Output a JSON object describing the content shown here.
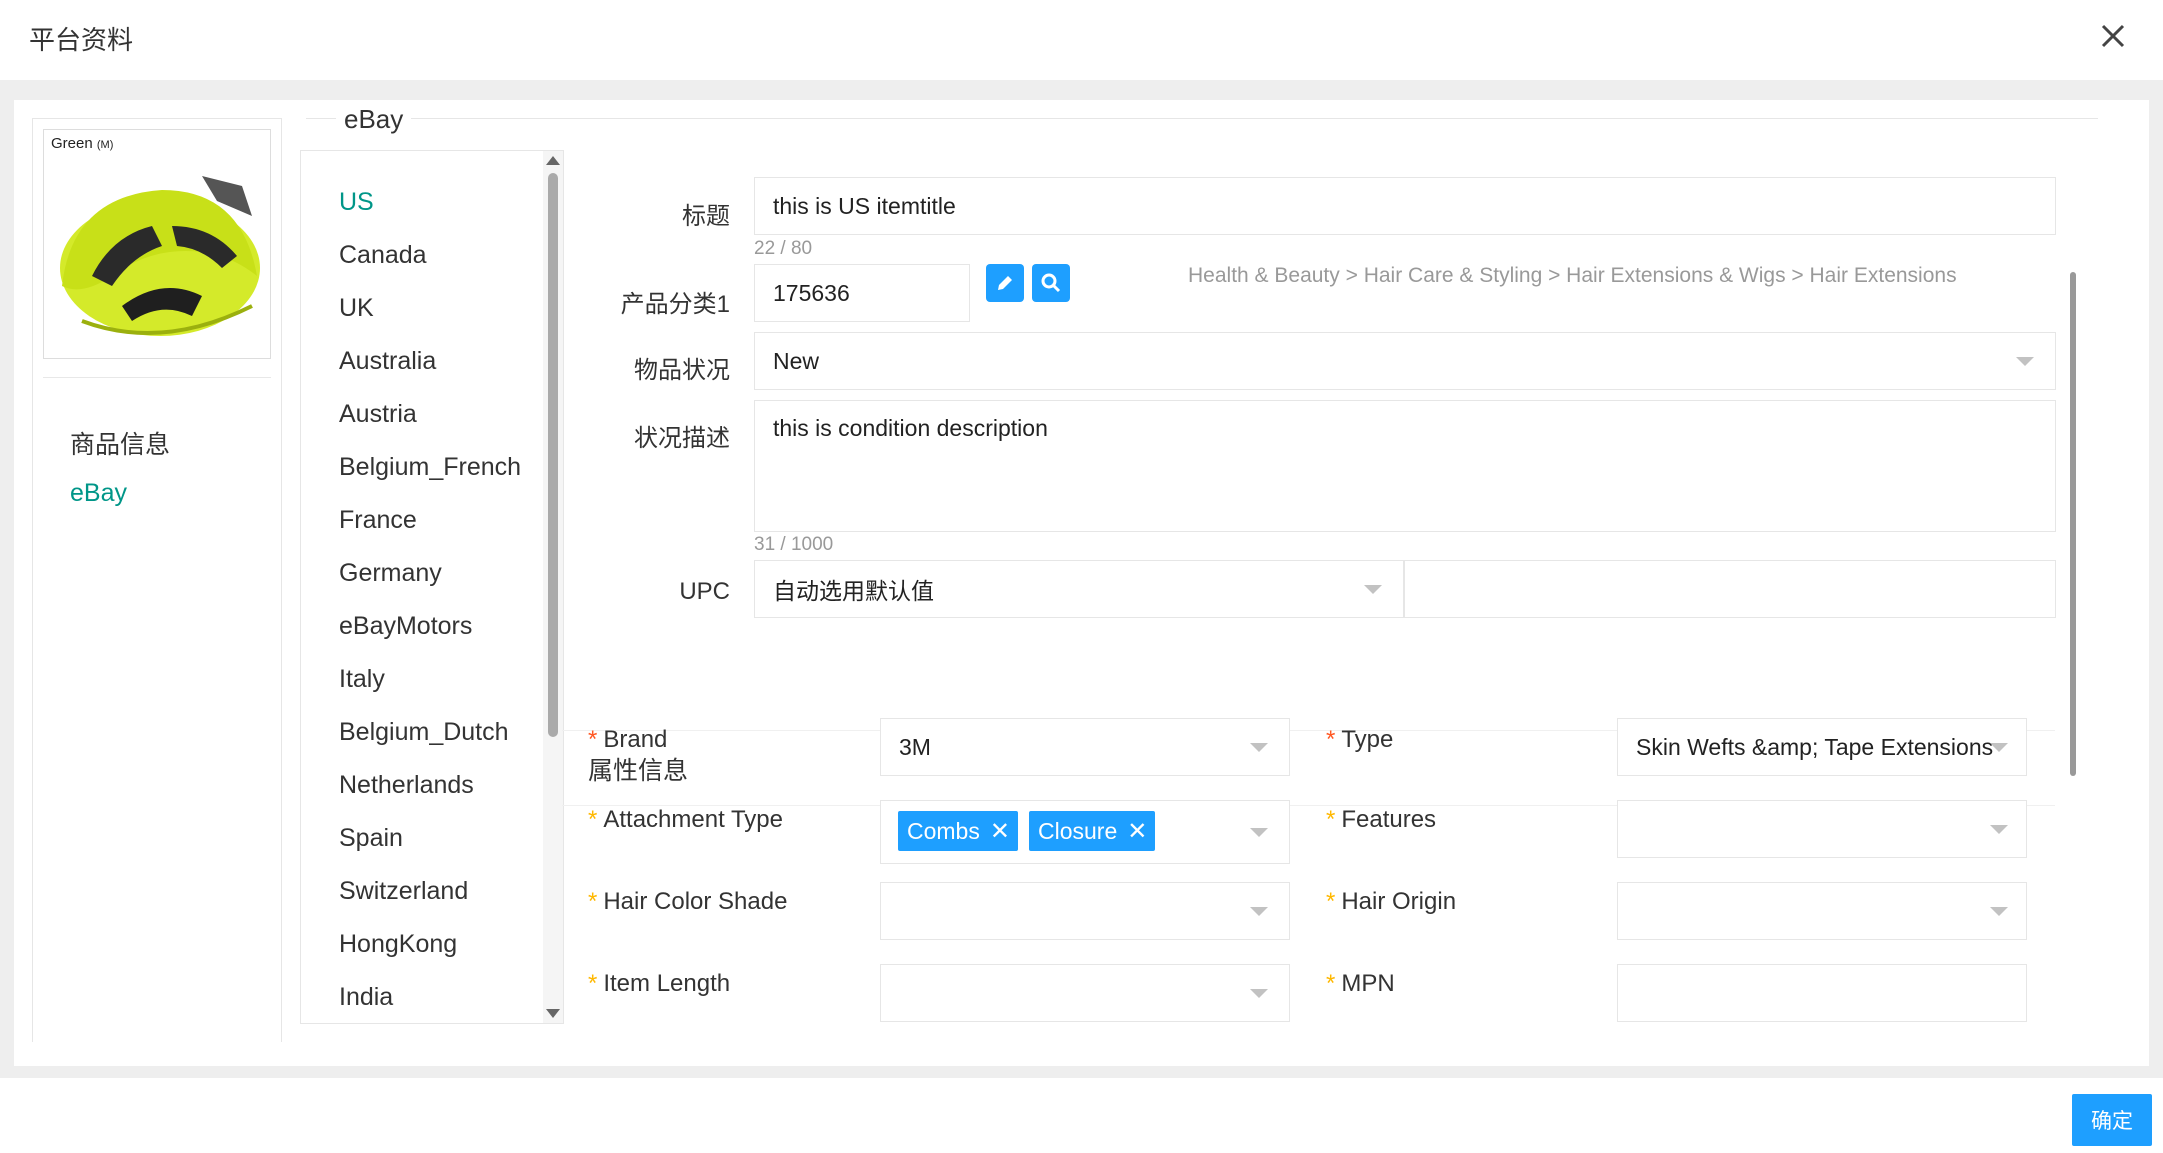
{
  "dialog": {
    "title": "平台资料",
    "confirm_label": "确定"
  },
  "product": {
    "color": "Green",
    "size": "(M)"
  },
  "leftnav": [
    {
      "label": "商品信息"
    },
    {
      "label": "eBay"
    }
  ],
  "section_title": "eBay",
  "sites": [
    "US",
    "Canada",
    "UK",
    "Australia",
    "Austria",
    "Belgium_French",
    "France",
    "Germany",
    "eBayMotors",
    "Italy",
    "Belgium_Dutch",
    "Netherlands",
    "Spain",
    "Switzerland",
    "HongKong",
    "India"
  ],
  "form": {
    "title_label": "标题",
    "title_value": "this is  US  itemtitle",
    "title_counter": "22 / 80",
    "category_label": "产品分类1",
    "category_value": "175636",
    "category_path": "Health & Beauty > Hair Care & Styling > Hair Extensions & Wigs > Hair Extensions",
    "condition_label": "物品状况",
    "condition_value": "New",
    "condition_desc_label": "状况描述",
    "condition_desc_value": "this is   condition description",
    "condition_desc_counter": "31 / 1000",
    "upc_label": "UPC",
    "upc_select": "自动选用默认值",
    "upc_value": ""
  },
  "attributes": {
    "heading": "属性信息",
    "brand_label": "Brand",
    "brand_value": "3M",
    "type_label": "Type",
    "type_value": "Skin Wefts &amp; Tape Extensions",
    "attachment_label": "Attachment Type",
    "attachment_tags": [
      "Combs",
      "Closure"
    ],
    "features_label": "Features",
    "features_value": "",
    "hair_color_label": "Hair Color Shade",
    "hair_color_value": "",
    "hair_origin_label": "Hair Origin",
    "hair_origin_value": "",
    "item_length_label": "Item Length",
    "item_length_value": "",
    "mpn_label": "MPN",
    "mpn_value": ""
  },
  "colors": {
    "accent": "#009688",
    "primary": "#1e9fff",
    "required": "#ff5722",
    "required_alt": "#ffb800"
  }
}
